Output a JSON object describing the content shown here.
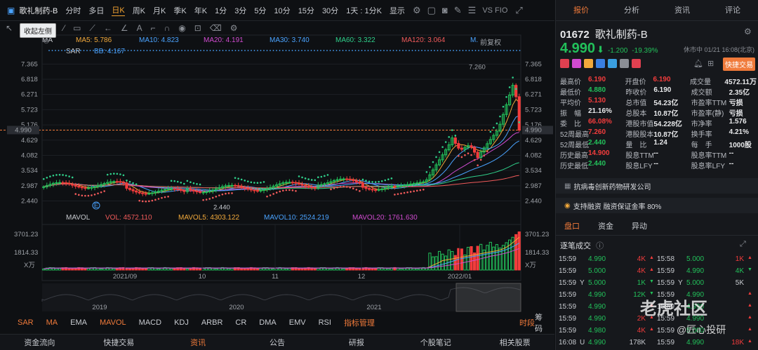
{
  "topbar": {
    "title": "歌礼制药-B",
    "periods": [
      "分时",
      "多日",
      "日K",
      "周K",
      "月K",
      "季K",
      "年K",
      "1分",
      "3分",
      "5分",
      "10分",
      "15分",
      "30分"
    ],
    "active": "日K",
    "settings": "1天 : 1分K",
    "display": "显示",
    "compare": "VS FIO"
  },
  "tooltip": "收起左侧",
  "ma": {
    "label": "MA",
    "ma5": "MA5: 5.786",
    "ma10": "MA10: 4.823",
    "ma20": "MA20: 4.191",
    "ma30": "MA30: 3.740",
    "ma60": "MA60: 3.322",
    "ma120": "MA120: 3.064",
    "m": "M.",
    "fq": "前复权"
  },
  "sar": {
    "label": "SAR",
    "bb": "BB: 4.167"
  },
  "price_ticks": [
    "7.365",
    "6.818",
    "6.271",
    "5.723",
    "5.176",
    "4.629",
    "4.082",
    "3.534",
    "2.987",
    "2.440"
  ],
  "price_ticks_right": [
    "7.365",
    "6.818",
    "6.271",
    "5.723",
    "5.176",
    "4.990",
    "4.629",
    "4.082",
    "3.534",
    "2.987",
    "2.440"
  ],
  "current_price_tag": "4.990",
  "left_price_tag": "4.990",
  "high_label": "7.260",
  "low_label": "2.440",
  "e_marker": "E",
  "vol": {
    "label": "MAVOL",
    "vol": "VOL: 4572.110",
    "mavol5": "MAVOL5: 4303.122",
    "mavol10": "MAVOL10: 2524.219",
    "mavol20": "MAVOL20: 1761.630"
  },
  "vol_ticks": [
    "3701.23",
    "1814.33",
    "X万"
  ],
  "x_labels": [
    "2021/09",
    "10",
    "11",
    "12",
    "2022/01"
  ],
  "overview_years": [
    "2019",
    "2020",
    "2021"
  ],
  "bottom_tabs": [
    "SAR",
    "MA",
    "EMA",
    "MAVOL",
    "MACD",
    "KDJ",
    "ARBR",
    "CR",
    "DMA",
    "EMV",
    "RSI",
    "指标管理"
  ],
  "bottom_right": [
    "时段",
    "筹码"
  ],
  "footer": [
    "资金流向",
    "快捷交易",
    "资讯",
    "公告",
    "研报",
    "个股笔记",
    "相关股票"
  ],
  "right": {
    "tabs": [
      "报价",
      "分析",
      "资讯",
      "评论"
    ],
    "code": "01672",
    "name": "歌礼制药-B",
    "price": "4.990",
    "change": "-1.200",
    "pct": "-19.39%",
    "status": "休市中 01/21 16:08(北京)",
    "quick_trade": "快捷交易",
    "quotes": [
      [
        [
          "最高价",
          "6.190",
          "red"
        ],
        [
          "开盘价",
          "6.190",
          "red"
        ],
        [
          "成交量",
          "4572.11万",
          ""
        ]
      ],
      [
        [
          "最低价",
          "4.880",
          "green"
        ],
        [
          "昨收价",
          "6.190",
          ""
        ],
        [
          "成交额",
          "2.35亿",
          ""
        ]
      ],
      [
        [
          "平均价",
          "5.130",
          "red"
        ],
        [
          "总市值",
          "54.23亿",
          ""
        ],
        [
          "市盈率TTM",
          "亏损",
          ""
        ]
      ],
      [
        [
          "振　幅",
          "21.16%",
          ""
        ],
        [
          "总股本",
          "10.87亿",
          ""
        ],
        [
          "市盈率(静)",
          "亏损",
          ""
        ]
      ],
      [
        [
          "委　比",
          "66.08%",
          "red"
        ],
        [
          "港股市值",
          "54.228亿",
          ""
        ],
        [
          "市净率",
          "1.576",
          ""
        ]
      ],
      [
        [
          "52周最高",
          "7.260",
          "red"
        ],
        [
          "港股股本",
          "10.87亿",
          ""
        ],
        [
          "换手率",
          "4.21%",
          ""
        ]
      ],
      [
        [
          "52周最低",
          "2.440",
          "green"
        ],
        [
          "量　比",
          "1.24",
          ""
        ],
        [
          "每　手",
          "1000股",
          ""
        ]
      ],
      [
        [
          "历史最高",
          "14.900",
          "red"
        ],
        [
          "股息TTM",
          "--",
          ""
        ],
        [
          "股息率TTM",
          "--",
          ""
        ]
      ],
      [
        [
          "历史最低",
          "2.440",
          "green"
        ],
        [
          "股息LFY",
          "--",
          ""
        ],
        [
          "股息率LFY",
          "--",
          ""
        ]
      ]
    ],
    "banner1": "抗病毒创新药物研发公司",
    "banner2": "支持融资 融资保证金率 80%",
    "sub_tabs": [
      "盘口",
      "资金",
      "异动"
    ],
    "ticks_title": "逐笔成交",
    "ticks": [
      [
        [
          "15:59",
          "",
          "4.990",
          "green",
          "4K",
          "red"
        ],
        [
          "15:58",
          "",
          "5.000",
          "green",
          "1K",
          "red"
        ]
      ],
      [
        [
          "15:59",
          "",
          "5.000",
          "green",
          "4K",
          "red"
        ],
        [
          "15:59",
          "",
          "4.990",
          "green",
          "4K",
          "green"
        ]
      ],
      [
        [
          "15:59",
          "Y",
          "5.000",
          "green",
          "1K",
          "green"
        ],
        [
          "15:59",
          "Y",
          "5.000",
          "green",
          "5K",
          ""
        ]
      ],
      [
        [
          "15:59",
          "",
          "4.990",
          "green",
          "12K",
          "green"
        ],
        [
          "15:59",
          "",
          "4.990",
          "green",
          "",
          "red"
        ]
      ],
      [
        [
          "15:59",
          "",
          "4.990",
          "green",
          "",
          "red"
        ],
        [
          "15:59",
          "",
          "4.990",
          "green",
          "",
          "red"
        ]
      ],
      [
        [
          "15:59",
          "",
          "4.990",
          "green",
          "2K",
          "red"
        ],
        [
          "15:59",
          "",
          "4.990",
          "green",
          "",
          "red"
        ]
      ],
      [
        [
          "15:59",
          "",
          "4.980",
          "green",
          "4K",
          "red"
        ],
        [
          "15:59",
          "",
          "5.000",
          "green",
          "",
          "red"
        ]
      ],
      [
        [
          "16:08",
          "U",
          "4.990",
          "green",
          "178K",
          ""
        ],
        [
          "15:59",
          "",
          "4.990",
          "green",
          "18K",
          "red"
        ]
      ]
    ]
  },
  "watermark1": "老虎社区",
  "watermark2": "@匠心投研"
}
